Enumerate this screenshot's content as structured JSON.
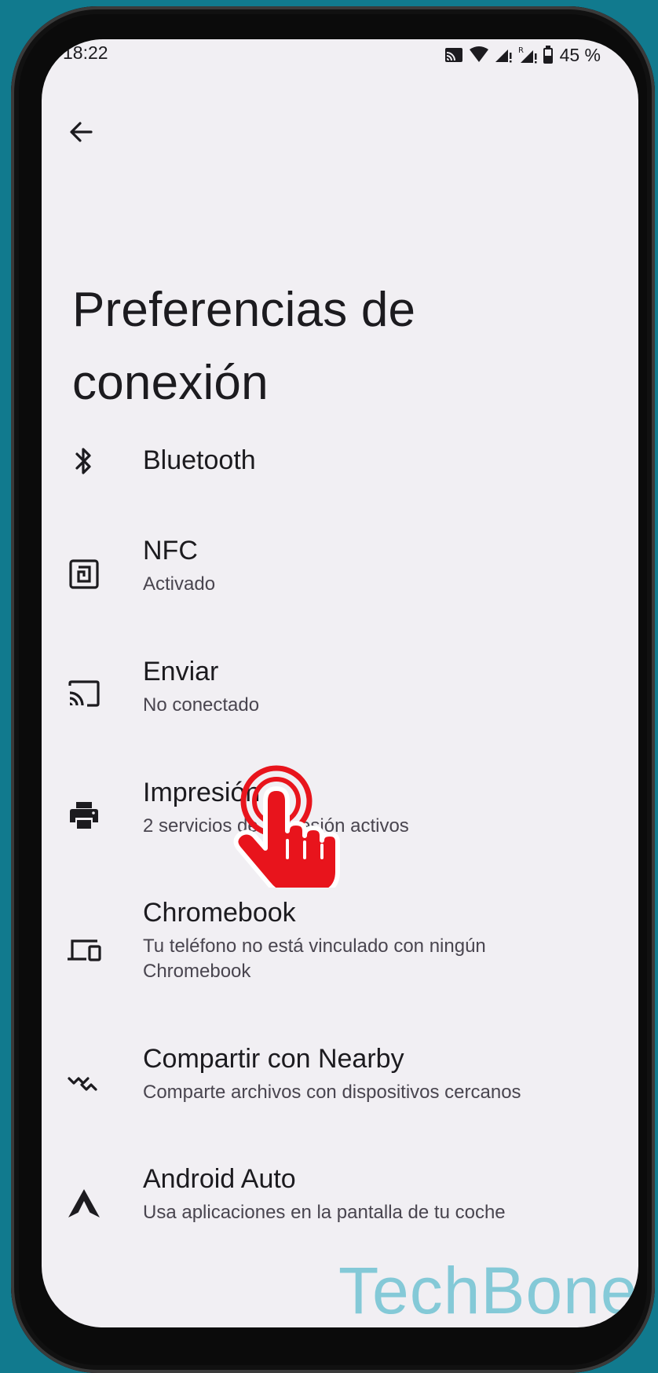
{
  "status_bar": {
    "time": "18:22",
    "battery": "45 %",
    "icons": [
      "cast-icon",
      "wifi-icon",
      "signal-icon",
      "signal-roaming-icon",
      "battery-icon"
    ]
  },
  "header": {
    "back_icon": "arrow-back-icon",
    "title": "Preferencias de conexión"
  },
  "items": [
    {
      "icon": "bluetooth-icon",
      "title": "Bluetooth",
      "summary": ""
    },
    {
      "icon": "nfc-icon",
      "title": "NFC",
      "summary": "Activado"
    },
    {
      "icon": "cast-icon",
      "title": "Enviar",
      "summary": "No conectado"
    },
    {
      "icon": "printer-icon",
      "title": "Impresión",
      "summary": "2 servicios de impresión activos"
    },
    {
      "icon": "devices-icon",
      "title": "Chromebook",
      "summary": "Tu teléfono no está vinculado con ningún Chromebook"
    },
    {
      "icon": "nearby-share-icon",
      "title": "Compartir con Nearby",
      "summary": "Comparte archivos con dispositivos cercanos"
    },
    {
      "icon": "android-auto-icon",
      "title": "Android Auto",
      "summary": "Usa aplicaciones en la pantalla de tu coche"
    }
  ],
  "watermark": "TechBone",
  "colors": {
    "background": "#117a8e",
    "screen": "#f1eff3",
    "text": "#1c1b1f",
    "secondary_text": "#49454f",
    "tap_indicator": "#e8141c",
    "watermark": "#7fc8d6"
  }
}
